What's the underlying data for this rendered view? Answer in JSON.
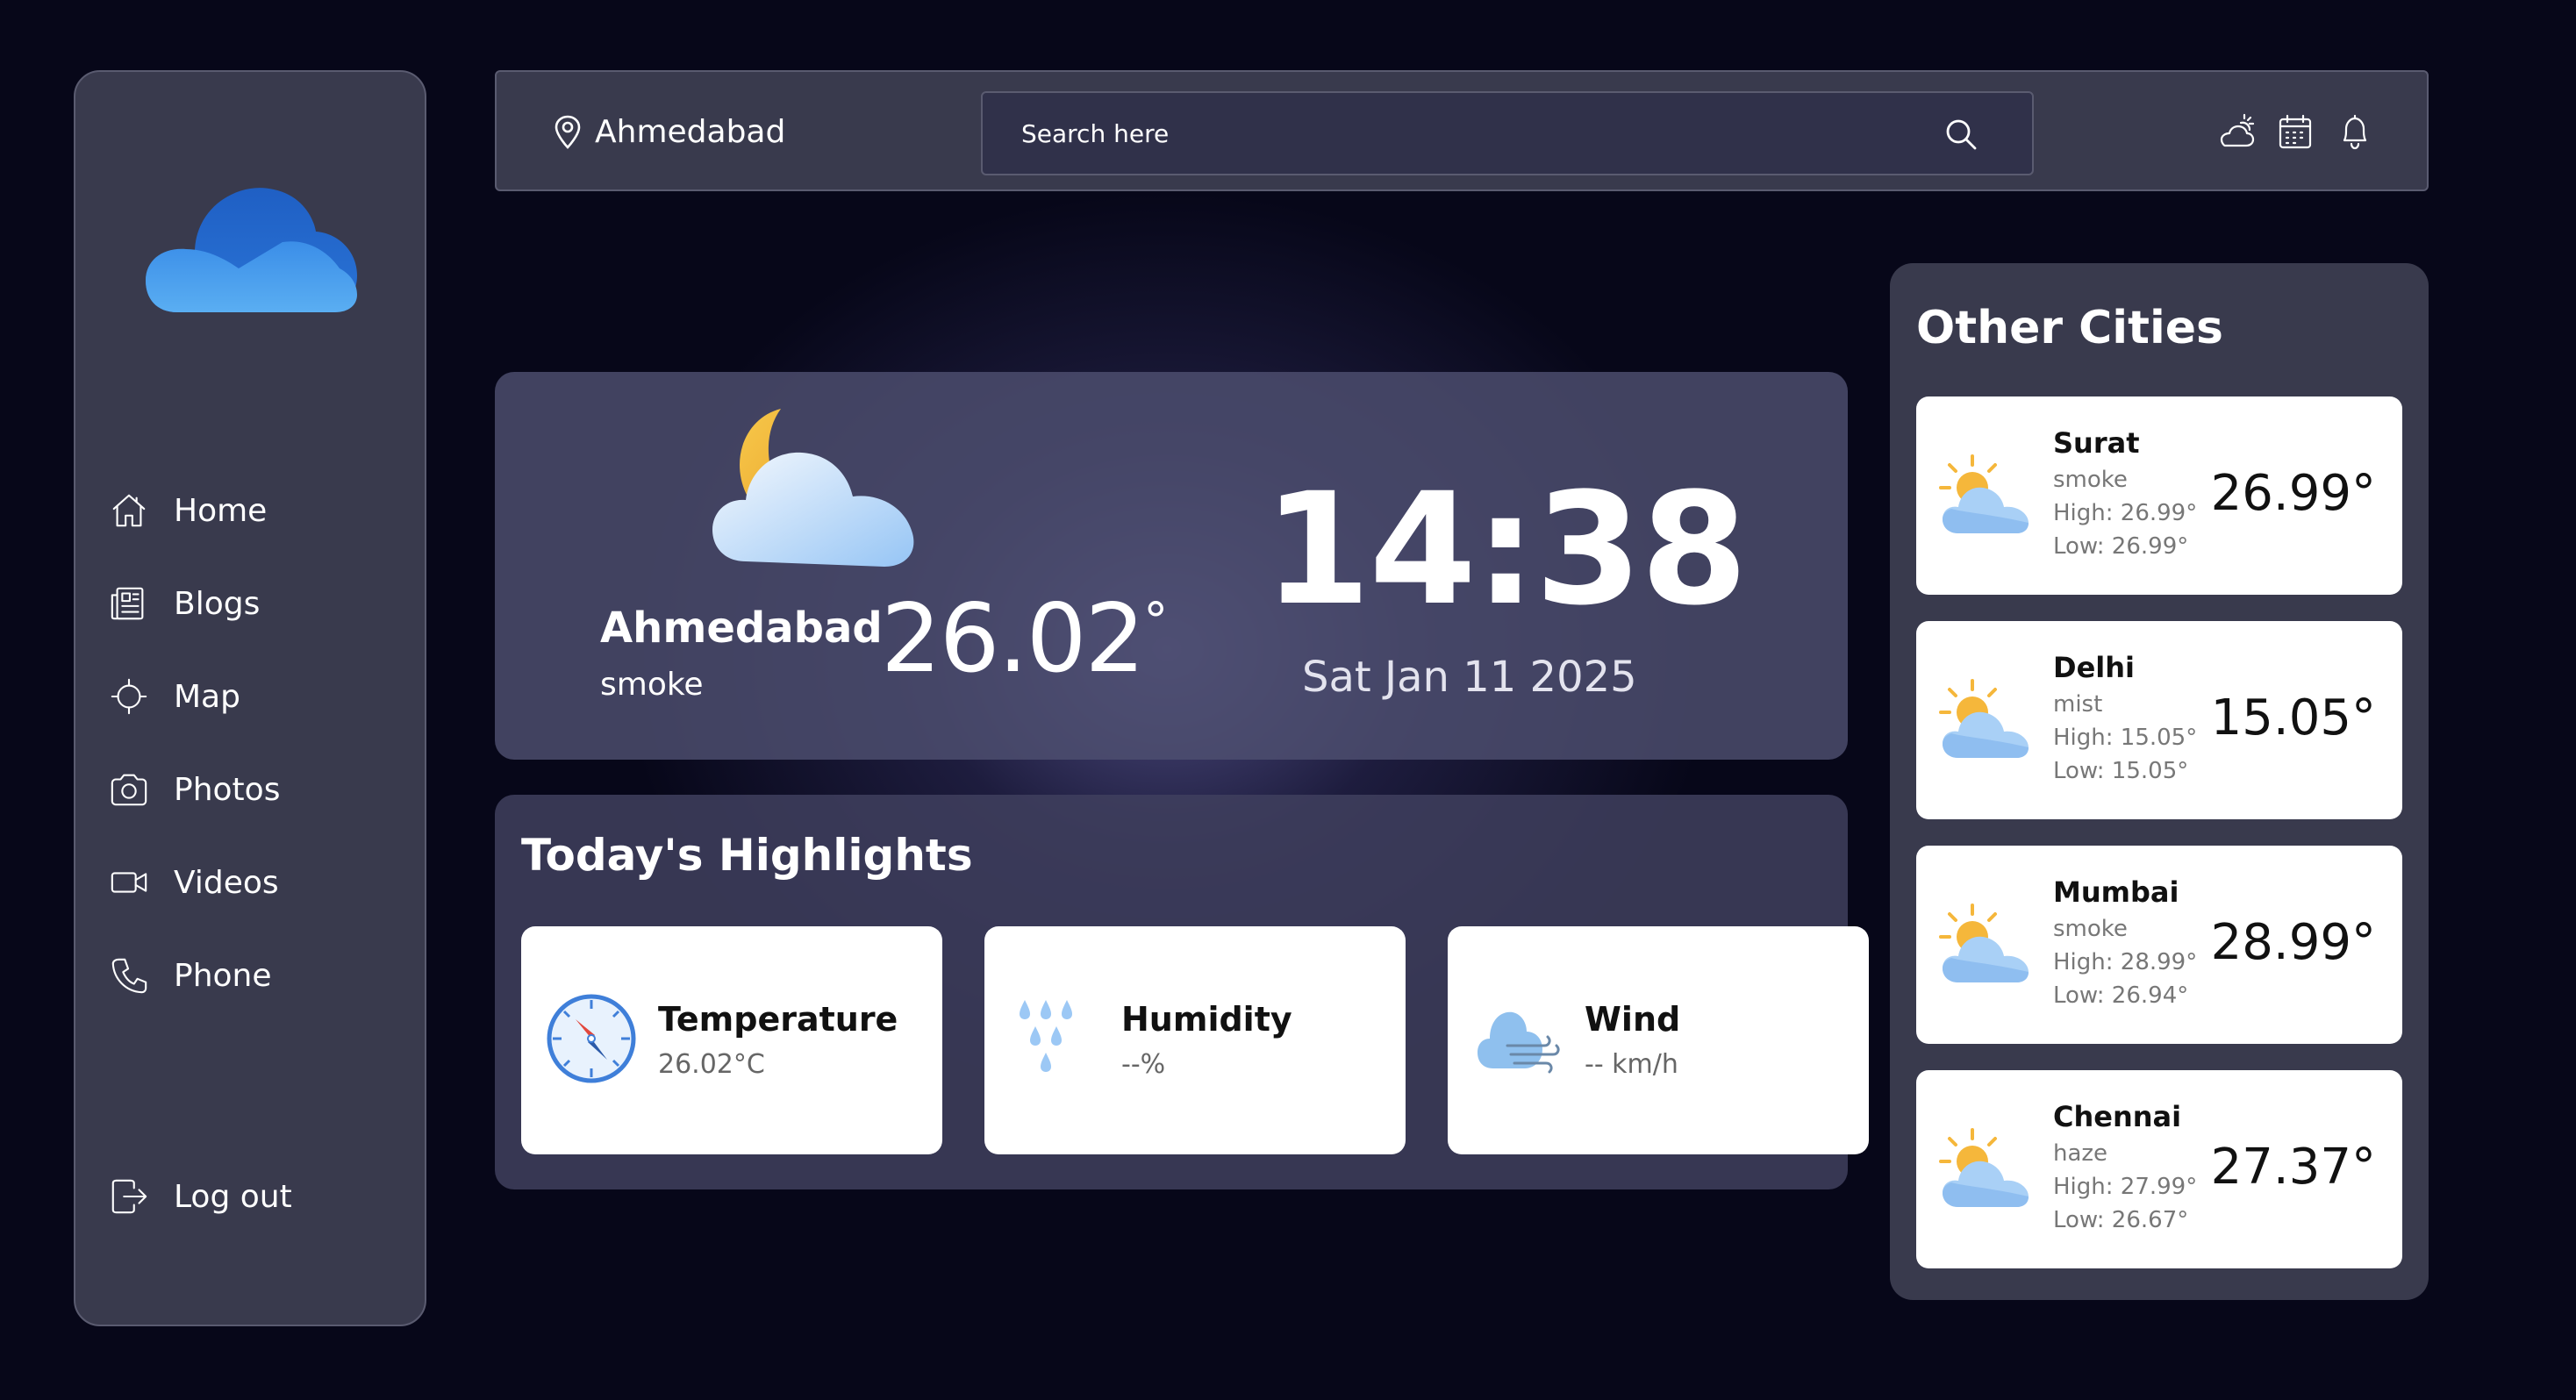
{
  "sidebar": {
    "logo_icon": "cloud-logo-icon",
    "items": [
      {
        "label": "Home",
        "icon": "home-icon"
      },
      {
        "label": "Blogs",
        "icon": "newspaper-icon"
      },
      {
        "label": "Map",
        "icon": "crosshair-icon"
      },
      {
        "label": "Photos",
        "icon": "camera-icon"
      },
      {
        "label": "Videos",
        "icon": "video-icon"
      },
      {
        "label": "Phone",
        "icon": "phone-icon"
      }
    ],
    "logout_label": "Log out"
  },
  "header": {
    "location": "Ahmedabad",
    "search_placeholder": "Search here",
    "icons": [
      "weather-icon",
      "calendar-icon",
      "bell-icon"
    ]
  },
  "current": {
    "city": "Ahmedabad",
    "condition": "smoke",
    "temperature": "26.02",
    "degree_symbol": "°",
    "time": "14:38",
    "date": "Sat Jan 11 2025",
    "icon": "moon-cloud-icon"
  },
  "highlights": {
    "title": "Today's Highlights",
    "cards": [
      {
        "name": "Temperature",
        "value": "26.02°C",
        "icon": "compass-icon"
      },
      {
        "name": "Humidity",
        "value": "--%",
        "icon": "rain-drops-icon"
      },
      {
        "name": "Wind",
        "value": "-- km/h",
        "icon": "wind-icon"
      }
    ]
  },
  "other_cities": {
    "title": "Other Cities",
    "cities": [
      {
        "name": "Surat",
        "condition": "smoke",
        "high": "High: 26.99°",
        "low": "Low: 26.99°",
        "temp": "26.99°"
      },
      {
        "name": "Delhi",
        "condition": "mist",
        "high": "High: 15.05°",
        "low": "Low: 15.05°",
        "temp": "15.05°"
      },
      {
        "name": "Mumbai",
        "condition": "smoke",
        "high": "High: 28.99°",
        "low": "Low: 26.94°",
        "temp": "28.99°"
      },
      {
        "name": "Chennai",
        "condition": "haze",
        "high": "High: 27.99°",
        "low": "Low: 26.67°",
        "temp": "27.37°"
      }
    ]
  },
  "colors": {
    "background": "#070719",
    "panel": "#393a4d",
    "card": "#ffffff",
    "accent_sun": "#f5b73b",
    "accent_cloud": "#9cc8f5"
  }
}
